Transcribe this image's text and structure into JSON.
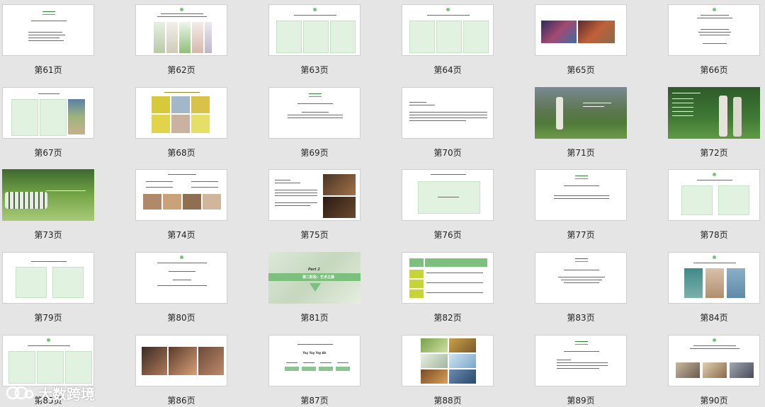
{
  "page_labels": [
    "第61页",
    "第62页",
    "第63页",
    "第64页",
    "第65页",
    "第66页",
    "第67页",
    "第68页",
    "第69页",
    "第70页",
    "第71页",
    "第72页",
    "第73页",
    "第74页",
    "第75页",
    "第76页",
    "第77页",
    "第78页",
    "第79页",
    "第80页",
    "第81页",
    "第82页",
    "第83页",
    "第84页",
    "第85页",
    "第86页",
    "第87页",
    "第88页",
    "第89页",
    "第90页"
  ],
  "slide_text": {
    "p81_part": "Part 2",
    "p81_sub": "第二阶段：艺术之美",
    "p87_title": "Yay Yay Yay Ah"
  },
  "watermark_text": "大数跨境",
  "colors": {
    "accent_green": "#7cbf7e",
    "box_green": "#e1f2e1",
    "bg": "#e5e5e5"
  }
}
